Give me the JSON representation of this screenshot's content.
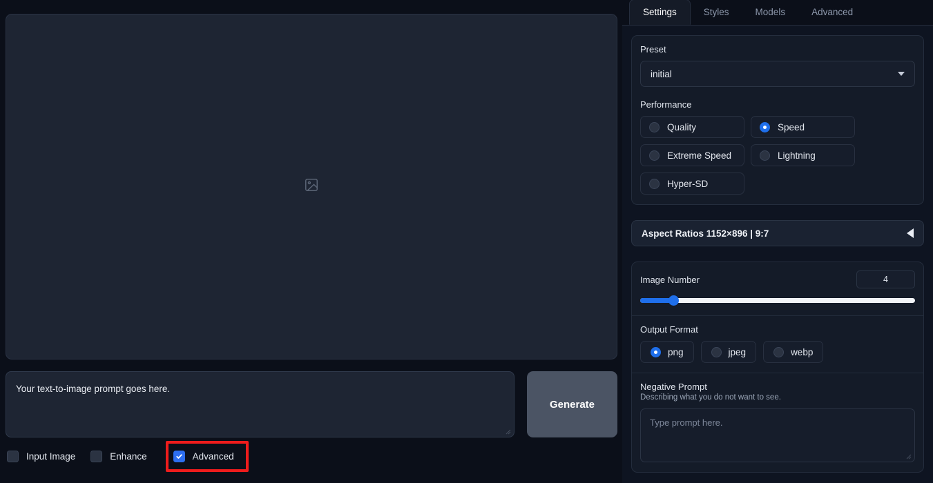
{
  "gallery": {
    "placeholder_icon": "image-placeholder-icon"
  },
  "prompt": {
    "value": "Your text-to-image prompt goes here.",
    "placeholder": "Type prompt here."
  },
  "generate": {
    "label": "Generate"
  },
  "checkboxes": [
    {
      "label": "Input Image",
      "checked": false
    },
    {
      "label": "Enhance",
      "checked": false
    },
    {
      "label": "Advanced",
      "checked": true,
      "highlighted": true
    }
  ],
  "tabs": [
    {
      "label": "Settings",
      "active": true
    },
    {
      "label": "Styles",
      "active": false
    },
    {
      "label": "Models",
      "active": false
    },
    {
      "label": "Advanced",
      "active": false
    }
  ],
  "preset": {
    "label": "Preset",
    "value": "initial",
    "caret_icon": "chevron-down-icon"
  },
  "performance": {
    "label": "Performance",
    "options": [
      {
        "label": "Quality",
        "selected": false
      },
      {
        "label": "Speed",
        "selected": true
      },
      {
        "label": "Extreme Speed",
        "selected": false
      },
      {
        "label": "Lightning",
        "selected": false
      },
      {
        "label": "Hyper-SD",
        "selected": false
      }
    ]
  },
  "aspect_ratios": {
    "label": "Aspect Ratios 1152×896 | 9:7",
    "collapse_icon": "triangle-left-icon"
  },
  "image_number": {
    "label": "Image Number",
    "value": "4",
    "min": 1,
    "max": 32,
    "fill_percent": 12
  },
  "output_format": {
    "label": "Output Format",
    "options": [
      {
        "label": "png",
        "selected": true
      },
      {
        "label": "jpeg",
        "selected": false
      },
      {
        "label": "webp",
        "selected": false
      }
    ]
  },
  "negative_prompt": {
    "label": "Negative Prompt",
    "description": "Describing what you do not want to see.",
    "placeholder": "Type prompt here.",
    "value": ""
  },
  "colors": {
    "accent": "#1f6feb",
    "highlight": "#ee1c1c",
    "panel_bg": "#0e1421",
    "card_bg": "#141b28",
    "generate_btn": "#4b5464"
  }
}
